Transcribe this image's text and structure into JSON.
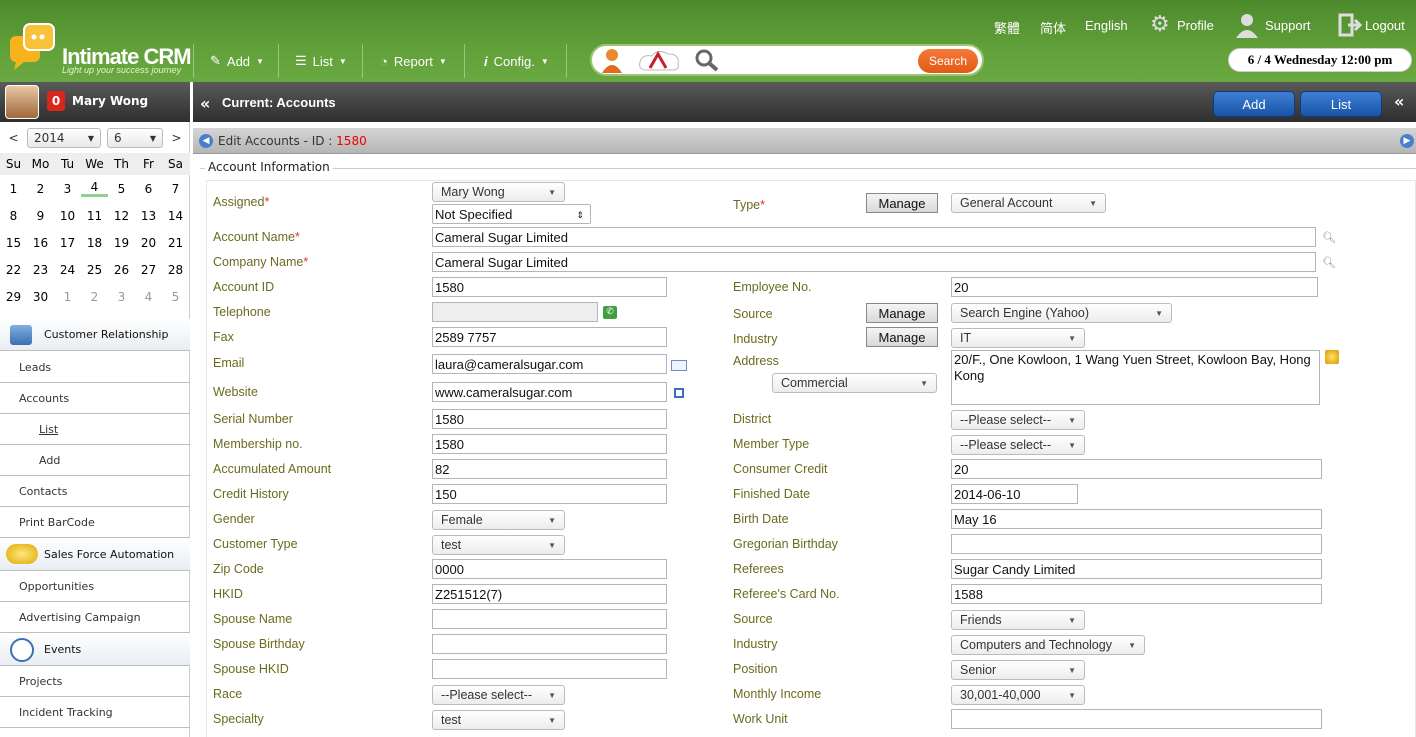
{
  "app": {
    "logo_name": "Intimate CRM",
    "logo_tagline": "Light up your success journey"
  },
  "top_menu": {
    "add": "Add",
    "list": "List",
    "report": "Report",
    "config": "Config."
  },
  "search": {
    "button": "Search",
    "placeholder": ""
  },
  "top_links": {
    "trad_chinese": "繁體",
    "simp_chinese": "简体",
    "english": "English",
    "profile": "Profile",
    "support": "Support",
    "logout": "Logout"
  },
  "datetime": "6 / 4  Wednesday  12:00 pm",
  "user": {
    "name": "Mary Wong",
    "notifications": "0"
  },
  "calendar": {
    "prev": "<",
    "next": ">",
    "year": "2014",
    "month": "6",
    "weekdays": [
      "Su",
      "Mo",
      "Tu",
      "We",
      "Th",
      "Fr",
      "Sa"
    ],
    "weeks": [
      [
        "1",
        "2",
        "3",
        "4",
        "5",
        "6",
        "7"
      ],
      [
        "8",
        "9",
        "10",
        "11",
        "12",
        "13",
        "14"
      ],
      [
        "15",
        "16",
        "17",
        "18",
        "19",
        "20",
        "21"
      ],
      [
        "22",
        "23",
        "24",
        "25",
        "26",
        "27",
        "28"
      ],
      [
        "29",
        "30",
        "1",
        "2",
        "3",
        "4",
        "5"
      ]
    ]
  },
  "sidebar": {
    "customer_relationship": "Customer Relationship",
    "leads": "Leads",
    "accounts": "Accounts",
    "list": "List",
    "add": "Add",
    "contacts": "Contacts",
    "print_barcode": "Print BarCode",
    "sales_force": "Sales Force Automation",
    "opportunities": "Opportunities",
    "advertising": "Advertising Campaign",
    "events": "Events",
    "projects": "Projects",
    "incident": "Incident Tracking"
  },
  "header": {
    "current": "Current: Accounts",
    "add_btn": "Add",
    "list_btn": "List"
  },
  "subheader": {
    "title": "Edit Accounts - ID : ",
    "id": "1580"
  },
  "section": "Account Information",
  "form": {
    "assigned_label": "Assigned",
    "assigned_value": "Mary Wong",
    "assigned_sub": "Not Specified",
    "type_label": "Type",
    "manage": "Manage",
    "type_value": "General Account",
    "account_name_label": "Account Name",
    "account_name": "Cameral Sugar Limited",
    "company_name_label": "Company Name",
    "company_name": "Cameral Sugar Limited",
    "account_id_label": "Account ID",
    "account_id": "1580",
    "employee_no_label": "Employee No.",
    "employee_no": "20",
    "telephone_label": "Telephone",
    "telephone": "",
    "source_label": "Source",
    "source_value": "Search Engine (Yahoo)",
    "fax_label": "Fax",
    "fax": "2589 7757",
    "industry_label": "Industry",
    "industry_value": "IT",
    "email_label": "Email",
    "email": "laura@cameralsugar.com",
    "address_label": "Address",
    "address_type": "Commercial",
    "address": "20/F., One Kowloon, 1 Wang Yuen Street, Kowloon Bay, Hong Kong",
    "website_label": "Website",
    "website": "www.cameralsugar.com",
    "serial_label": "Serial Number",
    "serial": "1580",
    "district_label": "District",
    "please_select": "--Please select--",
    "membership_label": "Membership no.",
    "membership": "1580",
    "member_type_label": "Member Type",
    "accumulated_label": "Accumulated Amount",
    "accumulated": "82",
    "consumer_credit_label": "Consumer Credit",
    "consumer_credit": "20",
    "credit_history_label": "Credit History",
    "credit_history": "150",
    "finished_date_label": "Finished Date",
    "finished_date": "2014-06-10",
    "gender_label": "Gender",
    "gender": "Female",
    "birth_date_label": "Birth Date",
    "birth_date": "May 16",
    "customer_type_label": "Customer Type",
    "customer_type": "test",
    "gregorian_label": "Gregorian Birthday",
    "gregorian": "",
    "zip_label": "Zip Code",
    "zip": "0000",
    "referees_label": "Referees",
    "referees": "Sugar Candy Limited",
    "hkid_label": "HKID",
    "hkid": "Z251512(7)",
    "referee_card_label": "Referee's Card No.",
    "referee_card": "1588",
    "spouse_name_label": "Spouse Name",
    "spouse_name": "",
    "source2_label": "Source",
    "source2": "Friends",
    "spouse_birthday_label": "Spouse Birthday",
    "spouse_birthday": "",
    "industry2_label": "Industry",
    "industry2": "Computers and Technology",
    "spouse_hkid_label": "Spouse HKID",
    "spouse_hkid": "",
    "position_label": "Position",
    "position": "Senior",
    "race_label": "Race",
    "race": "--Please select--",
    "monthly_income_label": "Monthly Income",
    "monthly_income": "30,001-40,000",
    "specialty_label": "Specialty",
    "specialty": "test",
    "work_unit_label": "Work Unit",
    "work_unit": ""
  }
}
